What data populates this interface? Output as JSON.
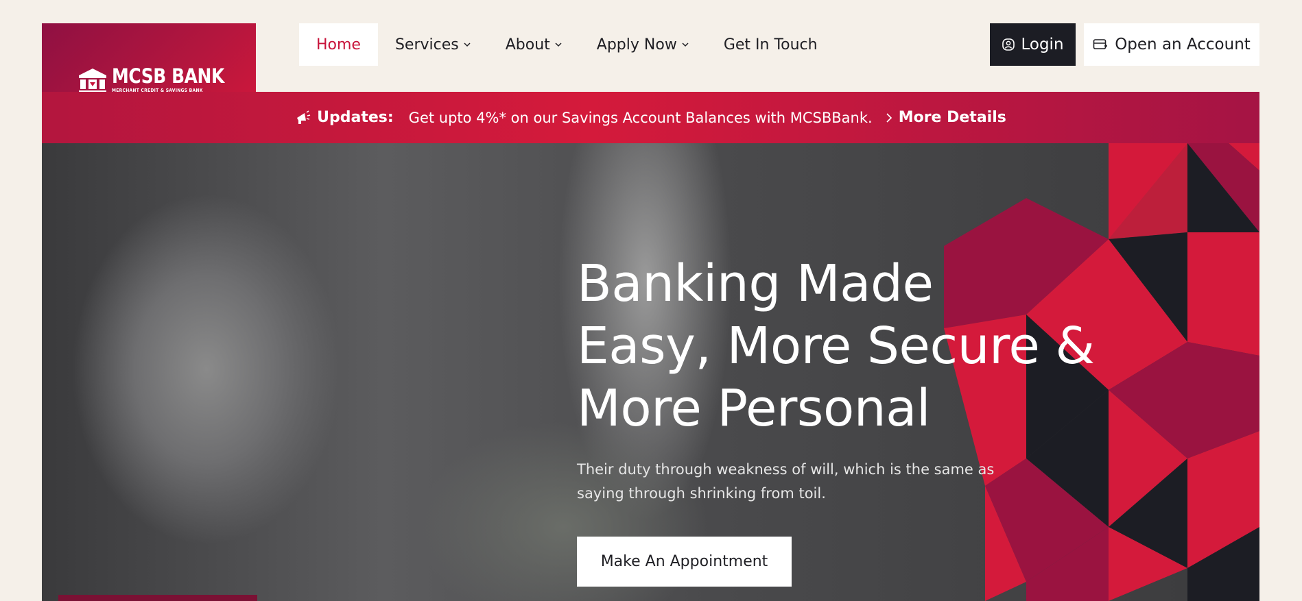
{
  "brand": {
    "name": "MCSB BANK",
    "tagline": "MERCHANT CREDIT & SAVINGS BANK"
  },
  "nav": {
    "items": [
      {
        "label": "Home",
        "active": true,
        "dropdown": false
      },
      {
        "label": "Services",
        "active": false,
        "dropdown": true
      },
      {
        "label": "About",
        "active": false,
        "dropdown": true
      },
      {
        "label": "Apply Now",
        "active": false,
        "dropdown": true
      },
      {
        "label": "Get In Touch",
        "active": false,
        "dropdown": false
      }
    ]
  },
  "header_actions": {
    "login_label": "Login",
    "open_account_label": "Open an Account"
  },
  "updates": {
    "label": "Updates:",
    "text": "Get upto 4%* on our Savings Account Balances with MCSBBank.",
    "link_label": "More Details"
  },
  "hero": {
    "title": "Banking Made\nEasy, More Secure &\nMore Personal",
    "subtitle": "Their duty through weakness of will, which is the same as saying through shrinking from toil.",
    "cta_label": "Make An Appointment"
  },
  "colors": {
    "brand_red": "#c8143b",
    "brand_maroon": "#8f1042",
    "dark": "#1c1d24",
    "page_bg": "#f5f0e9"
  },
  "icons": {
    "logo": "bank-logo-icon",
    "login": "user-circle-icon",
    "open_account": "card-plus-icon",
    "updates": "megaphone-icon",
    "more_details": "chevron-right-icon",
    "dropdown": "chevron-down-icon"
  }
}
